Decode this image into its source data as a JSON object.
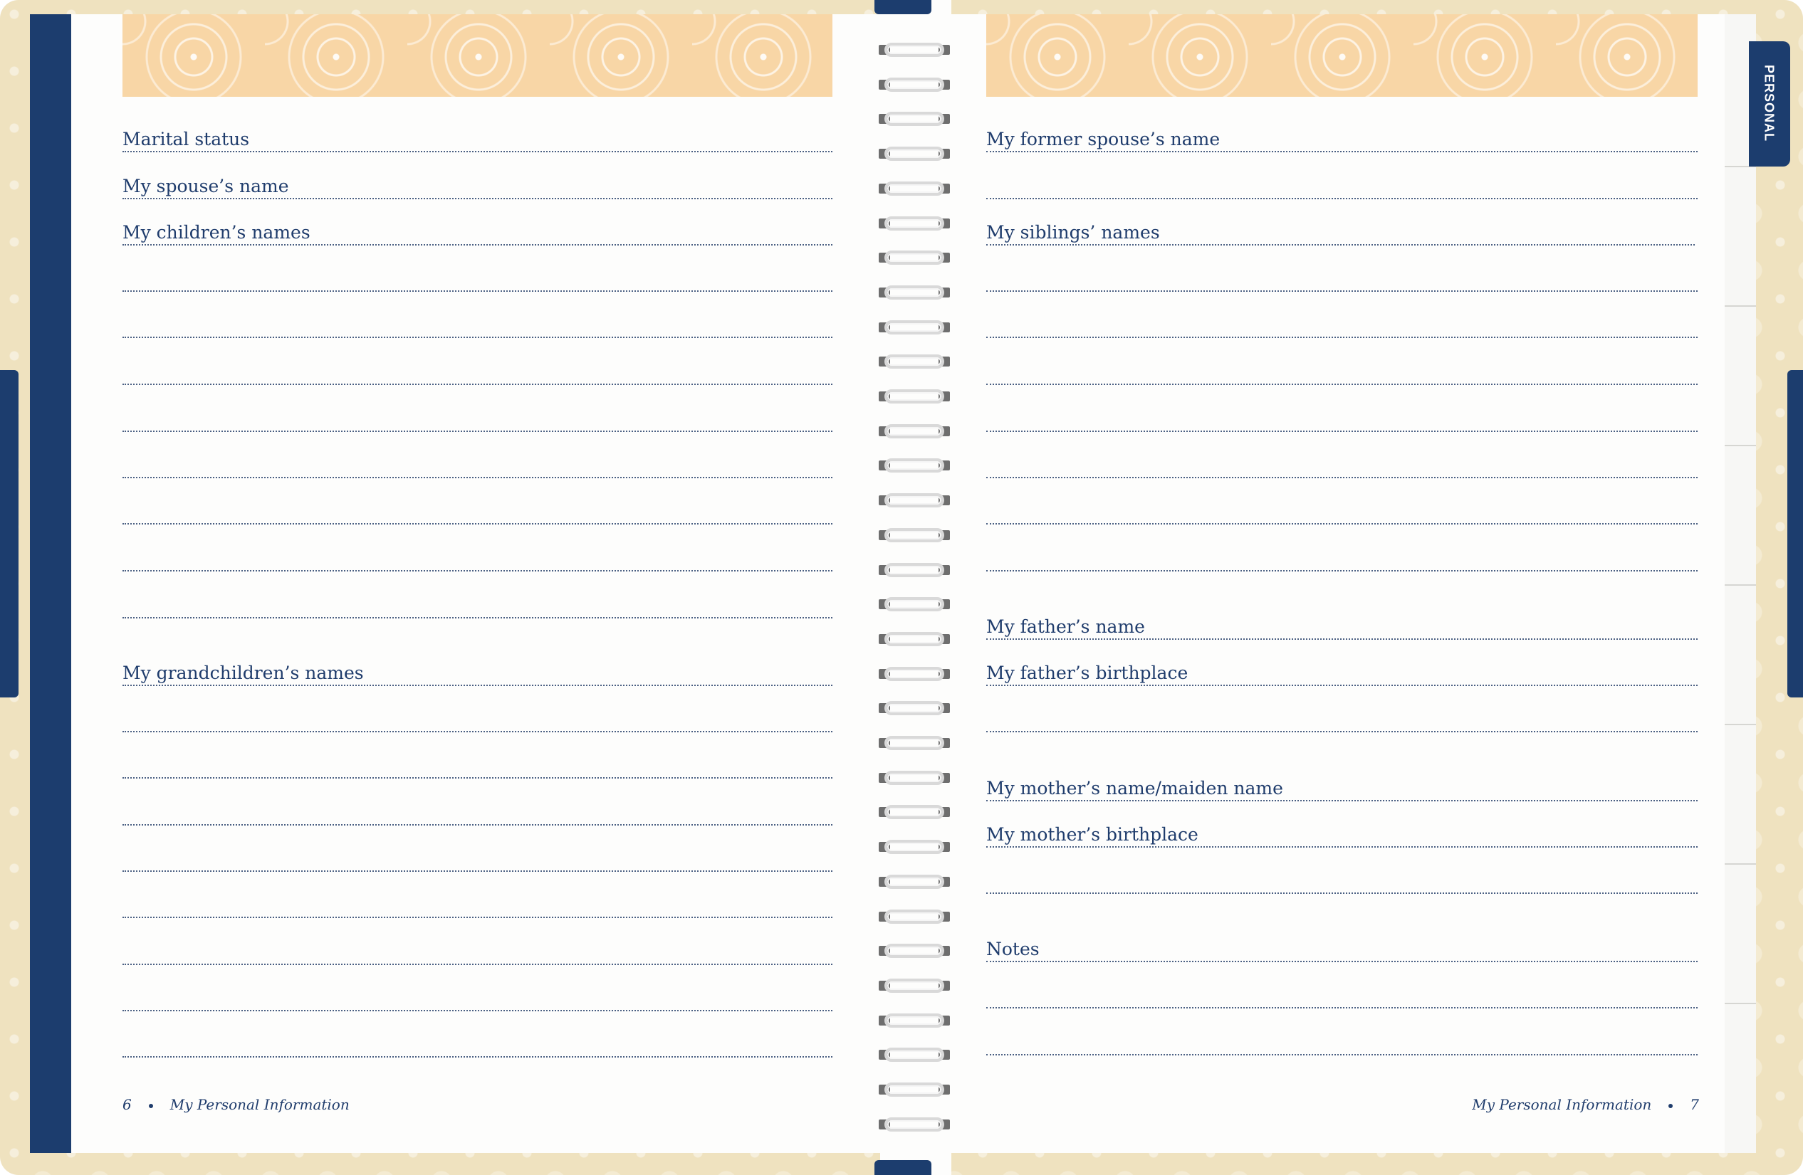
{
  "side_tab": {
    "label": "PERSONAL"
  },
  "left_page": {
    "fields": [
      {
        "label": "Marital status"
      },
      {
        "label": "My spouse’s name"
      },
      {
        "label": "My children’s names"
      },
      {
        "label": "My grandchildren’s names"
      }
    ],
    "footer": {
      "page_number": "6",
      "title": "My Personal Information"
    }
  },
  "right_page": {
    "fields": [
      {
        "label": "My former spouse’s name"
      },
      {
        "label": "My siblings’ names"
      },
      {
        "label": "My father’s name"
      },
      {
        "label": "My father’s birthplace"
      },
      {
        "label": "My mother’s name/maiden name"
      },
      {
        "label": "My mother’s birthplace"
      },
      {
        "label": "Notes"
      }
    ],
    "footer": {
      "page_number": "7",
      "title": "My Personal Information"
    }
  },
  "colors": {
    "navy": "#1c3d6e",
    "banner": "#f8d6a6",
    "text": "#1f3c6c"
  }
}
